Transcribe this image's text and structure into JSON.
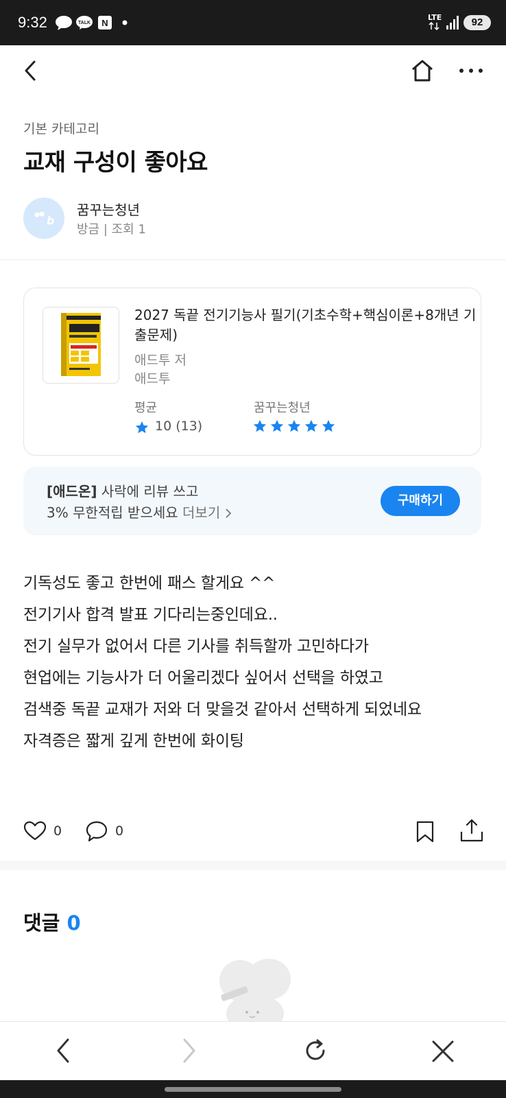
{
  "status_bar": {
    "time": "9:32",
    "network": "LTE",
    "battery": "92",
    "icons": [
      "chat-bubble-icon",
      "kakaotalk-icon",
      "naver-icon",
      "dot-icon"
    ]
  },
  "nav": {
    "back_icon": "back-chevron-icon",
    "home_icon": "home-icon",
    "more_icon": "more-dots-icon"
  },
  "post": {
    "category": "기본 카테고리",
    "title": "교재 구성이 좋아요",
    "author": "꿈꾸는청년",
    "meta": "방금 | 조회 1"
  },
  "book": {
    "title": "2027 독끝 전기기능사 필기(기초수학+핵심이론+8개년 기출문제)",
    "author": "애드투 저",
    "publisher": "애드투",
    "avg_label": "평균",
    "avg_value": "10 (13)",
    "rater_label": "꿈꾸는청년",
    "user_rating_stars": 5,
    "star_color": "#1a84f0"
  },
  "addon": {
    "tag": "[애드온]",
    "line1_rest": " 사락에 리뷰 쓰고",
    "line2": "3% 무한적립 받으세요",
    "more_label": "더보기",
    "buy_label": "구매하기"
  },
  "body_lines": [
    "기독성도 좋고 한번에 패스 할게요 ^^",
    "전기기사 합격 발표 기다리는중인데요..",
    "전기 실무가 없어서 다른 기사를 취득할까 고민하다가",
    "현업에는 기능사가 더 어울리겠다 싶어서 선택을 하였고",
    "검색중 독끝 교재가 저와 더 맞을것 같아서 선택하게 되었네요",
    "자격증은 짧게 깊게 한번에 화이팅"
  ],
  "actions": {
    "like_count": "0",
    "comment_count": "0"
  },
  "comments": {
    "title": "댓글",
    "count": "0"
  },
  "accent_color": "#1a84f0"
}
